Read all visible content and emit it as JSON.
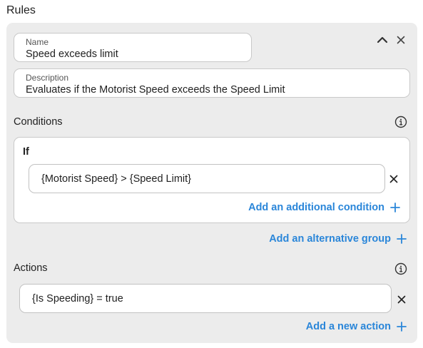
{
  "section_title": "Rules",
  "rule": {
    "name": {
      "label": "Name",
      "value": "Speed exceeds limit"
    },
    "description": {
      "label": "Description",
      "value": "Evaluates if the Motorist Speed exceeds the Speed Limit"
    }
  },
  "conditions": {
    "title": "Conditions",
    "group_label": "If",
    "items": [
      "{Motorist Speed} > {Speed Limit}"
    ],
    "add_condition_label": "Add an additional condition",
    "add_group_label": "Add an alternative group"
  },
  "actions": {
    "title": "Actions",
    "items": [
      "{Is Speeding} = true"
    ],
    "add_action_label": "Add a new action"
  },
  "colors": {
    "accent": "#2a86d9",
    "panel_bg": "#ececec",
    "border": "#c9c9c9"
  },
  "icons": [
    "chevron-up-icon",
    "close-icon",
    "info-icon",
    "plus-icon"
  ]
}
